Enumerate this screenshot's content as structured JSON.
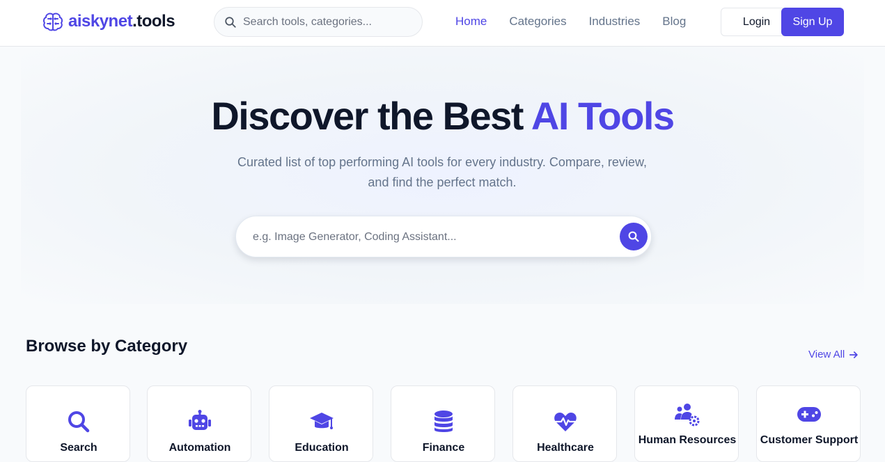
{
  "brand": {
    "name": "aiskynet",
    "tld": ".tools"
  },
  "nav": {
    "search_placeholder": "Search tools, categories...",
    "links": [
      "Home",
      "Categories",
      "Industries",
      "Blog"
    ],
    "login_label": "Login",
    "signup_label": "Sign Up"
  },
  "hero": {
    "title": "Discover the Best",
    "title_accent": "AI Tools",
    "subtitle": "Curated list of top performing AI tools for every industry. Compare, review, and find the perfect match.",
    "search_placeholder": "e.g. Image Generator, Coding Assistant..."
  },
  "categories": {
    "title": "Browse by Category",
    "view_all_label": "View All",
    "items": [
      {
        "label": "Search",
        "icon": "search-icon"
      },
      {
        "label": "Automation",
        "icon": "robot-icon"
      },
      {
        "label": "Education",
        "icon": "graduation-cap-icon"
      },
      {
        "label": "Finance",
        "icon": "database-icon"
      },
      {
        "label": "Healthcare",
        "icon": "heart-pulse-icon"
      },
      {
        "label": "Human Resources",
        "icon": "users-gear-icon"
      },
      {
        "label": "Customer Support",
        "icon": "gamepad-icon"
      }
    ]
  },
  "colors": {
    "accent": "#4f46e5",
    "text": "#0f172a",
    "muted": "#64748b"
  }
}
